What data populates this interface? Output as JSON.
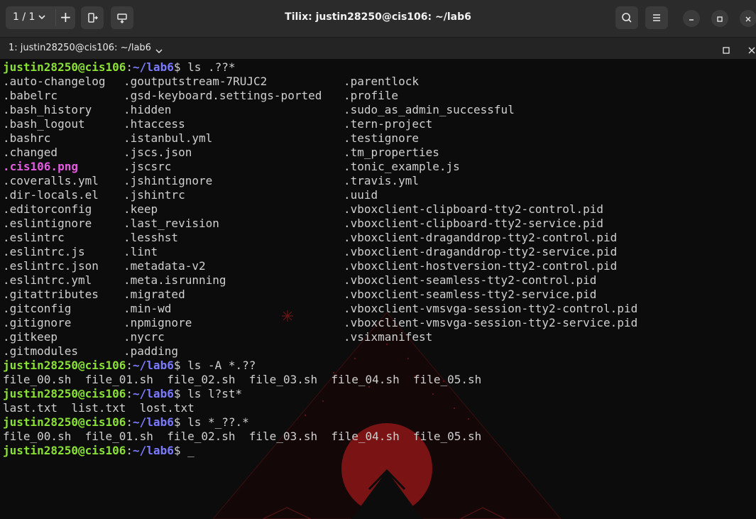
{
  "header": {
    "session_counter": "1 / 1",
    "plus_label": "+",
    "title": "Tilix: justin28250@cis106: ~/lab6"
  },
  "tab": {
    "label": "1: justin28250@cis106: ~/lab6"
  },
  "terminal": {
    "prompt_user": "justin28250@cis106",
    "prompt_path": "~/lab6",
    "prompt_sep": ":",
    "prompt_end": "$ ",
    "cursor": "_",
    "commands": [
      "ls .??*",
      "ls -A *.??",
      "ls l?st*",
      "ls *_??.*"
    ],
    "listing_rows": [
      [
        ".auto-changelog",
        ".goutputstream-7RUJC2",
        ".parentlock"
      ],
      [
        ".babelrc",
        ".gsd-keyboard.settings-ported",
        ".profile"
      ],
      [
        ".bash_history",
        ".hidden",
        ".sudo_as_admin_successful"
      ],
      [
        ".bash_logout",
        ".htaccess",
        ".tern-project"
      ],
      [
        ".bashrc",
        ".istanbul.yml",
        ".testignore"
      ],
      [
        ".changed",
        ".jscs.json",
        ".tm_properties"
      ],
      [
        ".cis106.png",
        ".jscsrc",
        ".tonic_example.js"
      ],
      [
        ".coveralls.yml",
        ".jshintignore",
        ".travis.yml"
      ],
      [
        ".dir-locals.el",
        ".jshintrc",
        ".uuid"
      ],
      [
        ".editorconfig",
        ".keep",
        ".vboxclient-clipboard-tty2-control.pid"
      ],
      [
        ".eslintignore",
        ".last_revision",
        ".vboxclient-clipboard-tty2-service.pid"
      ],
      [
        ".eslintrc",
        ".lesshst",
        ".vboxclient-draganddrop-tty2-control.pid"
      ],
      [
        ".eslintrc.js",
        ".lint",
        ".vboxclient-draganddrop-tty2-service.pid"
      ],
      [
        ".eslintrc.json",
        ".metadata-v2",
        ".vboxclient-hostversion-tty2-control.pid"
      ],
      [
        ".eslintrc.yml",
        ".meta.isrunning",
        ".vboxclient-seamless-tty2-control.pid"
      ],
      [
        ".gitattributes",
        ".migrated",
        ".vboxclient-seamless-tty2-service.pid"
      ],
      [
        ".gitconfig",
        ".min-wd",
        ".vboxclient-vmsvga-session-tty2-control.pid"
      ],
      [
        ".gitignore",
        ".npmignore",
        ".vboxclient-vmsvga-session-tty2-service.pid"
      ],
      [
        ".gitkeep",
        ".nycrc",
        ".vsixmanifest"
      ],
      [
        ".gitmodules",
        ".padding",
        ""
      ]
    ],
    "output_2": "file_00.sh  file_01.sh  file_02.sh  file_03.sh  file_04.sh  file_05.sh",
    "output_3": "last.txt  list.txt  lost.txt",
    "output_4": "file_00.sh  file_01.sh  file_02.sh  file_03.sh  file_04.sh  file_05.sh"
  },
  "colors": {
    "prompt_user": "#8ae234",
    "prompt_path": "#7b7bff",
    "image_file": "#e25cdf",
    "text": "#d0d0d0",
    "wallpaper_accent": "#7a1414"
  }
}
